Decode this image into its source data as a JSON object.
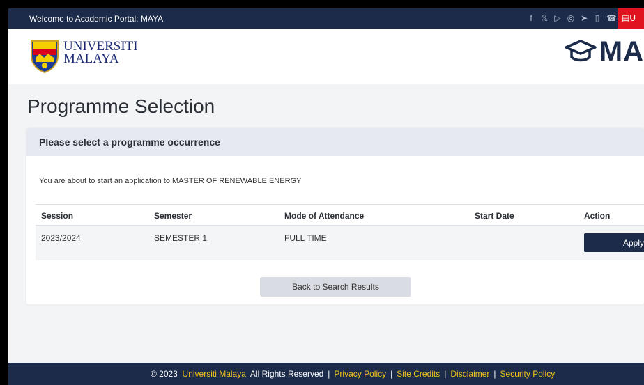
{
  "topbar": {
    "welcome": "Welcome to Academic Portal: MAYA",
    "social_icons": [
      "facebook-icon",
      "twitter-icon",
      "youtube-icon",
      "instagram-icon",
      "telegram-icon",
      "tablet-icon",
      "phone-icon"
    ],
    "red_button_label": "U"
  },
  "header": {
    "brand_line1": "UNIVERSITI",
    "brand_line2": "MALAYA",
    "maya_logo_text": "MA"
  },
  "page": {
    "title": "Programme Selection"
  },
  "card": {
    "heading": "Please select a programme occurrence",
    "intro": "You are about to start an application to MASTER OF RENEWABLE ENERGY",
    "table": {
      "headers": [
        "Session",
        "Semester",
        "Mode of Attendance",
        "Start Date",
        "Action"
      ],
      "rows": [
        {
          "session": "2023/2024",
          "semester": "SEMESTER 1",
          "mode": "FULL TIME",
          "start_date": "",
          "action_label": "Apply"
        }
      ]
    },
    "back_label": "Back to Search Results"
  },
  "footer": {
    "copyright": "© 2023",
    "university": "Universiti Malaya",
    "rights": "All Rights Reserved",
    "links": [
      "Privacy Policy",
      "Site Credits",
      "Disclaimer",
      "Security Policy"
    ]
  },
  "colors": {
    "navy": "#1c2b4a",
    "accent_red": "#e0141e",
    "link_yellow": "#f2c21b",
    "card_head_bg": "#e6e9ef"
  }
}
